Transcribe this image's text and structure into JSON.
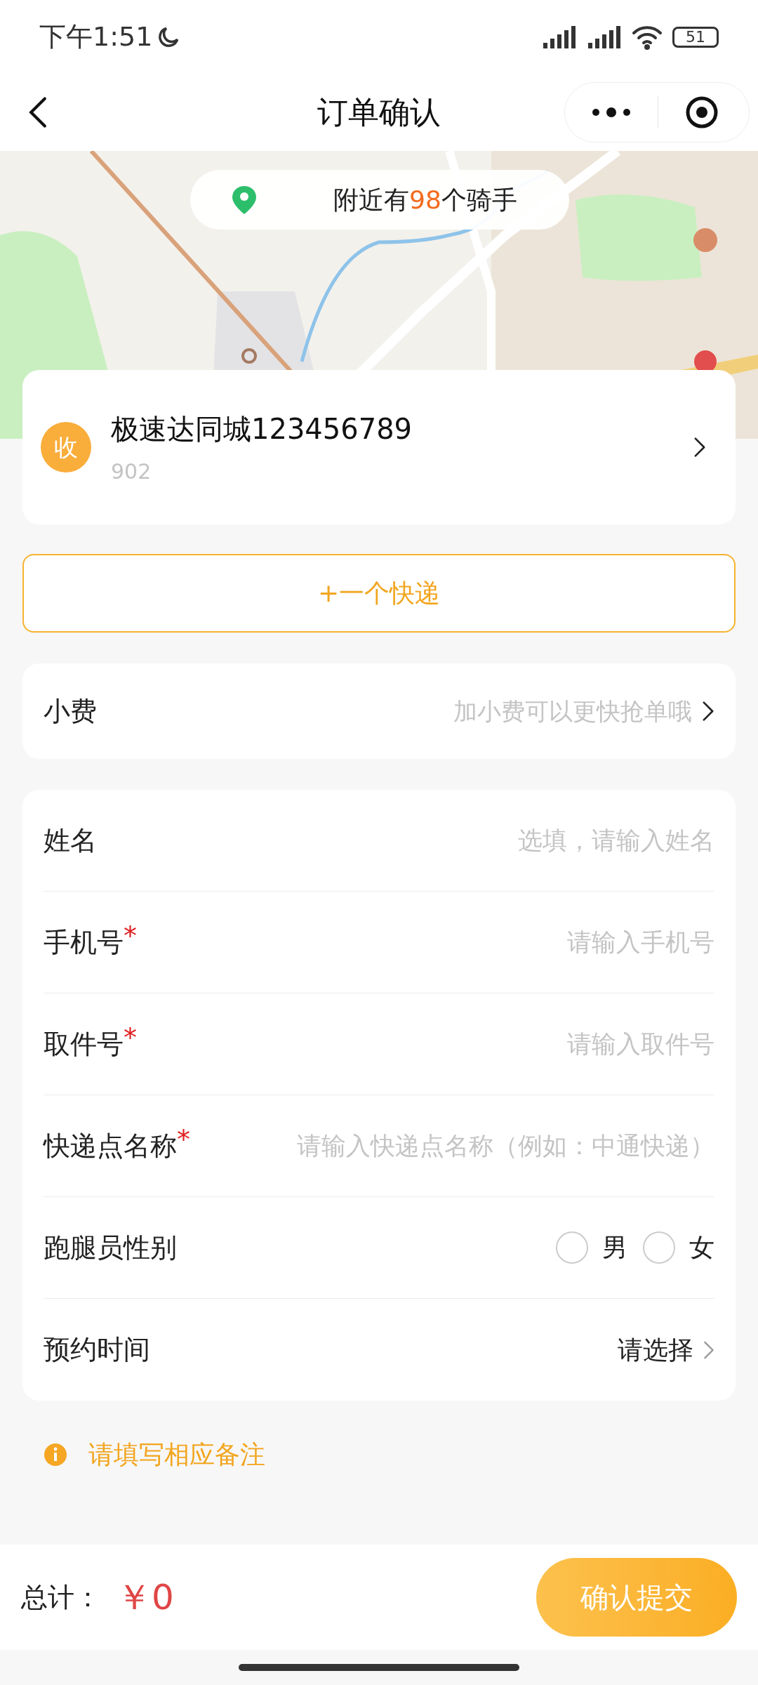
{
  "status_bar": {
    "time": "下午1:51",
    "battery": "51"
  },
  "header": {
    "title": "订单确认"
  },
  "map_badge": {
    "prefix": "附近有",
    "count": "98",
    "suffix": "个骑手"
  },
  "receiver": {
    "badge": "收",
    "name": "极速达同城123456789",
    "detail": "902"
  },
  "add_button": "+一个快递",
  "tip": {
    "label": "小费",
    "placeholder": "加小费可以更快抢单哦"
  },
  "form": [
    {
      "kind": "input",
      "label": "姓名",
      "placeholder": "选填，请输入姓名"
    },
    {
      "kind": "input",
      "label": "手机号",
      "required_mark": "*",
      "placeholder": "请输入手机号"
    },
    {
      "kind": "input",
      "label": "取件号",
      "required_mark": "*",
      "placeholder": "请输入取件号"
    },
    {
      "kind": "input",
      "label": "快递点名称",
      "required_mark": "*",
      "placeholder": "请输入快递点名称（例如：中通快递）"
    },
    {
      "kind": "radio",
      "label": "跑腿员性别",
      "options": [
        {
          "label": "男",
          "selected": false
        },
        {
          "label": "女",
          "selected": false
        }
      ]
    },
    {
      "kind": "select",
      "label": "预约时间",
      "value": "请选择"
    }
  ],
  "note": "请填写相应备注",
  "footer": {
    "total_label": "总计：",
    "total": "￥0",
    "submit": "确认提交"
  }
}
